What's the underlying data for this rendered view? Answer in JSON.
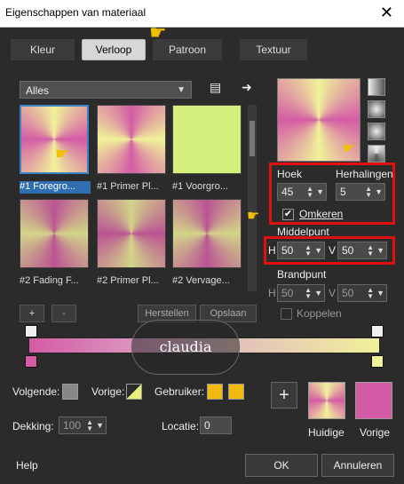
{
  "window": {
    "title": "Eigenschappen van materiaal",
    "close": "✕"
  },
  "tabs": [
    "Kleur",
    "Verloop",
    "Patroon",
    "Textuur"
  ],
  "active_tab": "Verloop",
  "dropdown": {
    "value": "Alles"
  },
  "thumbs": [
    {
      "label": "#1 Foregro...",
      "selected": true
    },
    {
      "label": "#1 Primer Pl...",
      "selected": false
    },
    {
      "label": "#1 Voorgro...",
      "selected": false
    },
    {
      "label": "#2 Fading F...",
      "selected": false
    },
    {
      "label": "#2 Primer Pl...",
      "selected": false
    },
    {
      "label": "#2 Vervage...",
      "selected": false
    }
  ],
  "buttons": {
    "add": "+",
    "remove": "-",
    "restore": "Herstellen",
    "save": "Opslaan",
    "add_big": "+",
    "ok": "OK",
    "cancel": "Annuleren",
    "help": "Help"
  },
  "right": {
    "hoek_label": "Hoek",
    "herhalingen_label": "Herhalingen",
    "hoek_value": "45",
    "herhalingen_value": "5",
    "omkeren_label": "Omkeren",
    "middelpunt_label": "Middelpunt",
    "h_label": "H",
    "v_label": "V",
    "middel_h": "50",
    "middel_v": "50",
    "brandpunt_label": "Brandpunt",
    "brand_h": "50",
    "brand_v": "50",
    "koppelen_label": "Koppelen"
  },
  "bottom": {
    "volgende_label": "Volgende:",
    "vorige_label": "Vorige:",
    "gebruiker_label": "Gebruiker:",
    "dekking_label": "Dekking:",
    "dekking_value": "100",
    "locatie_label": "Locatie:",
    "locatie_value": "0",
    "huidige_label": "Huidige",
    "vorige2_label": "Vorige"
  },
  "watermark": "claudia",
  "colors": {
    "pink": "#d45ca6",
    "yellow": "#f1f29a",
    "accent": "#3b82c4",
    "red": "#e01010",
    "gold": "#f2b90f"
  }
}
